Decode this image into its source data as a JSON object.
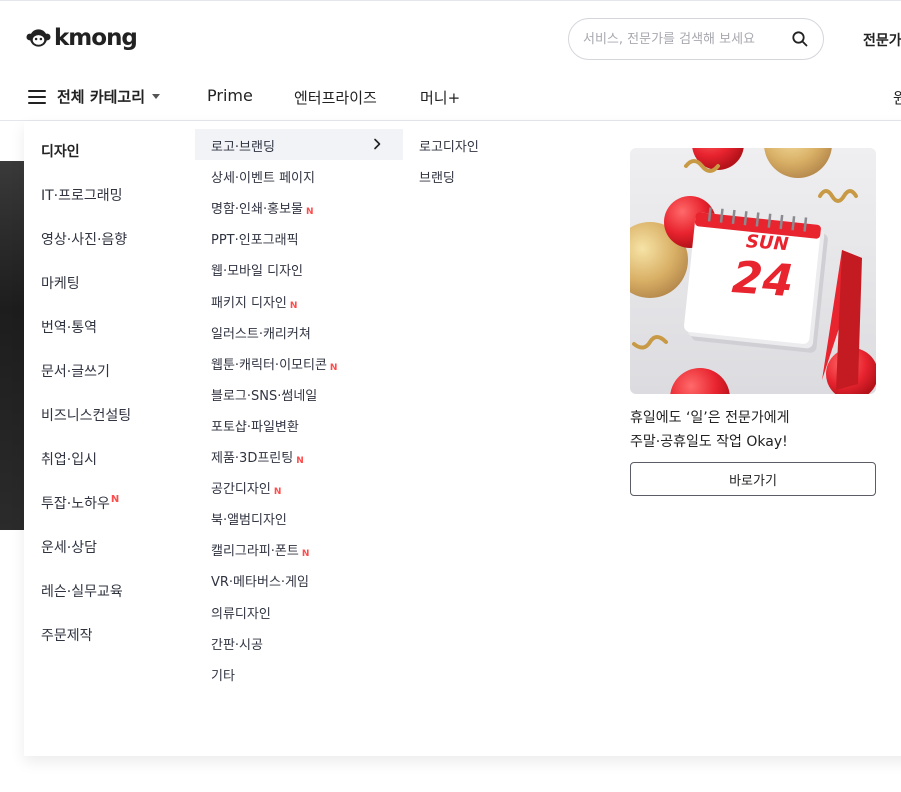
{
  "header": {
    "logo_text": "kmong",
    "search_placeholder": "서비스, 전문가를 검색해 보세요",
    "right_link": "전문가"
  },
  "nav": {
    "category_label": "전체 카테고리",
    "links": [
      "Prime",
      "엔터프라이즈",
      "머니+"
    ],
    "cut_text": "원"
  },
  "categories": [
    {
      "label": "디자인",
      "active": true,
      "is_new": false
    },
    {
      "label": "IT·프로그래밍",
      "is_new": false
    },
    {
      "label": "영상·사진·음향",
      "is_new": false
    },
    {
      "label": "마케팅",
      "is_new": false
    },
    {
      "label": "번역·통역",
      "is_new": false
    },
    {
      "label": "문서·글쓰기",
      "is_new": false
    },
    {
      "label": "비즈니스컨설팅",
      "is_new": false
    },
    {
      "label": "취업·입시",
      "is_new": false
    },
    {
      "label": "투잡·노하우",
      "is_new": true
    },
    {
      "label": "운세·상담",
      "is_new": false
    },
    {
      "label": "레슨·실무교육",
      "is_new": false
    },
    {
      "label": "주문제작",
      "is_new": false
    }
  ],
  "subcategories": [
    {
      "label": "로고·브랜딩",
      "active": true,
      "is_new": false
    },
    {
      "label": "상세·이벤트 페이지",
      "is_new": false
    },
    {
      "label": "명함·인쇄·홍보물",
      "is_new": true
    },
    {
      "label": "PPT·인포그래픽",
      "is_new": false
    },
    {
      "label": "웹·모바일 디자인",
      "is_new": false
    },
    {
      "label": "패키지 디자인",
      "is_new": true
    },
    {
      "label": "일러스트·캐리커쳐",
      "is_new": false
    },
    {
      "label": "웹툰·캐릭터·이모티콘",
      "is_new": true
    },
    {
      "label": "블로그·SNS·썸네일",
      "is_new": false
    },
    {
      "label": "포토샵·파일변환",
      "is_new": false
    },
    {
      "label": "제품·3D프린팅",
      "is_new": true
    },
    {
      "label": "공간디자인",
      "is_new": true
    },
    {
      "label": "북·앨범디자인",
      "is_new": false
    },
    {
      "label": "캘리그라피·폰트",
      "is_new": true
    },
    {
      "label": "VR·메타버스·게임",
      "is_new": false
    },
    {
      "label": "의류디자인",
      "is_new": false
    },
    {
      "label": "간판·시공",
      "is_new": false
    },
    {
      "label": "기타",
      "is_new": false
    }
  ],
  "new_badge": "N",
  "subsubcategories": [
    "로고디자인",
    "브랜딩"
  ],
  "promo": {
    "calendar_day": "SUN",
    "calendar_date": "24",
    "line1": "휴일에도 ‘일’은 전문가에게",
    "line2": "주말·공휴일도 작업 Okay!",
    "button_label": "바로가기"
  },
  "colors": {
    "new_badge": "#ff4b4b",
    "active_bg": "#f2f3f7",
    "promo_bg": "#e9e9ec",
    "calendar_red": "#e8242f"
  },
  "icons": {
    "search": "search-icon",
    "menu": "hamburger-icon",
    "caret": "caret-down-icon",
    "chevron": "chevron-right-icon"
  }
}
